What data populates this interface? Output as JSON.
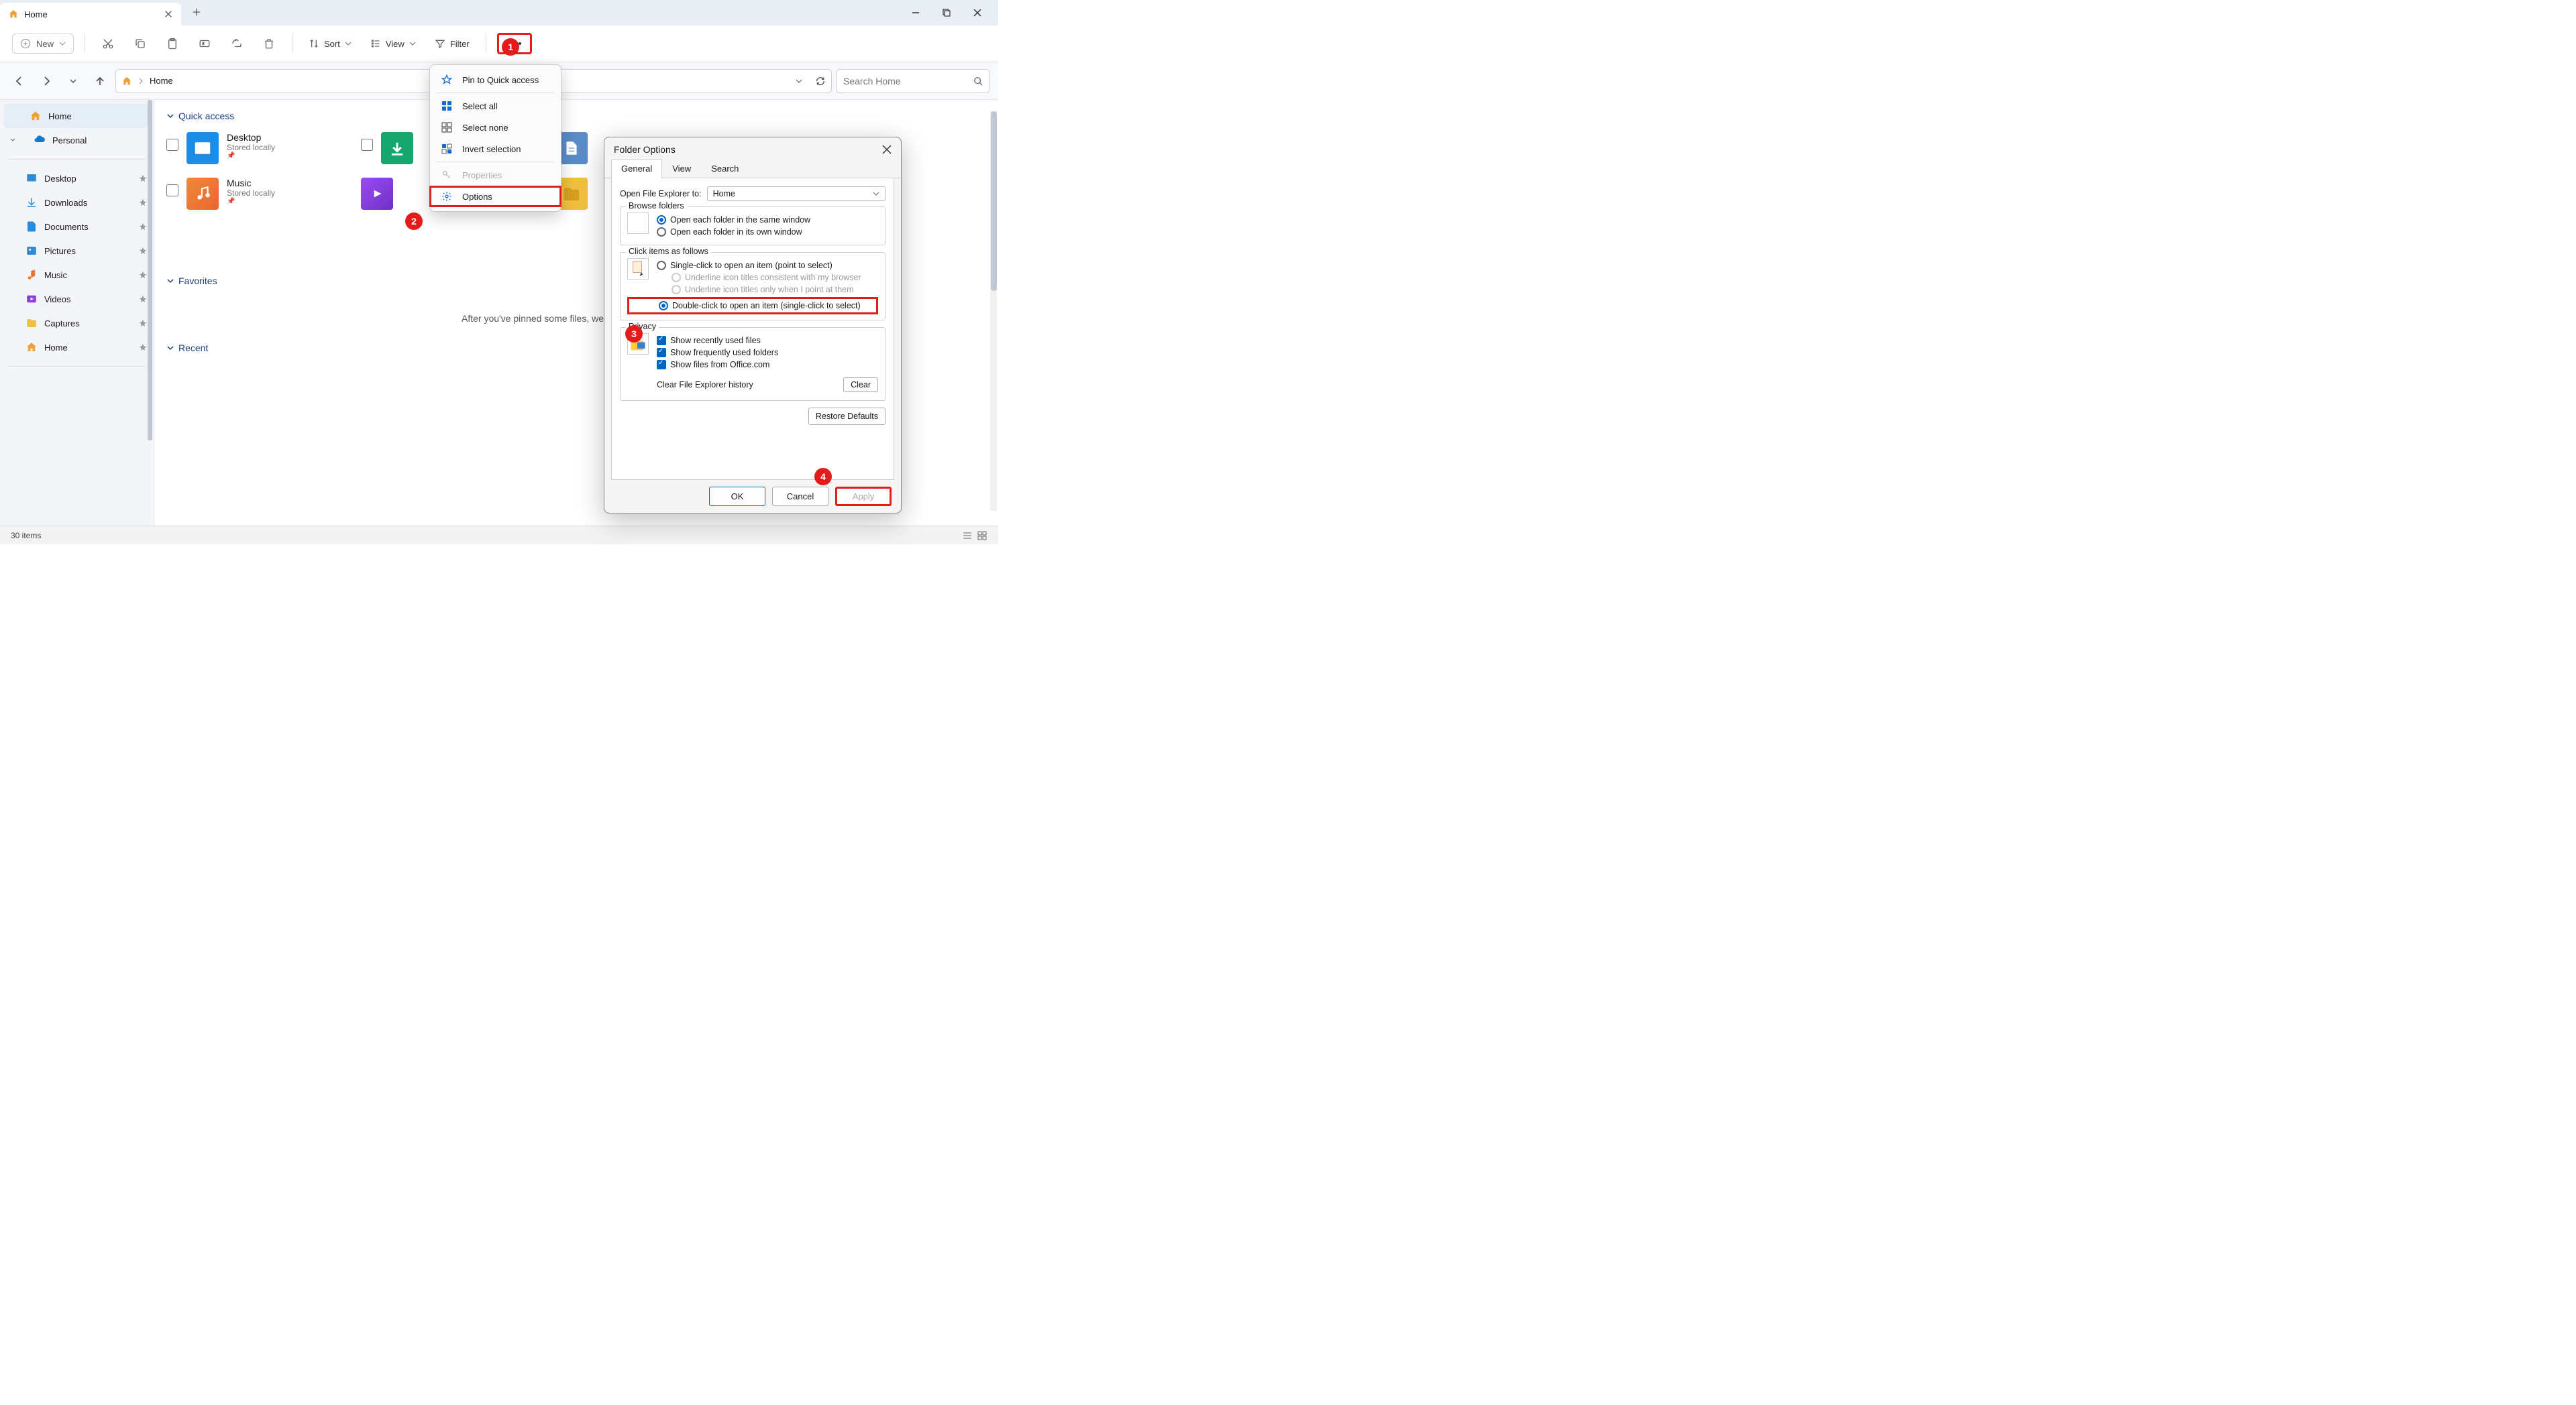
{
  "window": {
    "tab_title": "Home",
    "new_btn": "New",
    "sort_btn": "Sort",
    "view_btn": "View",
    "filter_btn": "Filter"
  },
  "address": {
    "path": "Home",
    "search_placeholder": "Search Home"
  },
  "sidebar": {
    "items": [
      {
        "label": "Home",
        "selected": true
      },
      {
        "label": "Personal"
      }
    ],
    "quick": [
      {
        "label": "Desktop"
      },
      {
        "label": "Downloads"
      },
      {
        "label": "Documents"
      },
      {
        "label": "Pictures"
      },
      {
        "label": "Music"
      },
      {
        "label": "Videos"
      },
      {
        "label": "Captures"
      },
      {
        "label": "Home"
      }
    ]
  },
  "content": {
    "section_qa": "Quick access",
    "section_fav": "Favorites",
    "section_recent": "Recent",
    "qa_items": [
      {
        "title": "Desktop",
        "sub": "Stored locally"
      },
      {
        "title": "Music",
        "sub": "Stored locally"
      }
    ],
    "empty_favorites": "After you've pinned some files, we'"
  },
  "context_menu": {
    "pin": "Pin to Quick access",
    "select_all": "Select all",
    "select_none": "Select none",
    "invert": "Invert selection",
    "properties": "Properties",
    "options": "Options"
  },
  "dialog": {
    "title": "Folder Options",
    "tabs": [
      "General",
      "View",
      "Search"
    ],
    "open_to_label": "Open File Explorer to:",
    "open_to_value": "Home",
    "browse_title": "Browse folders",
    "browse_same": "Open each folder in the same window",
    "browse_own": "Open each folder in its own window",
    "click_title": "Click items as follows",
    "click_single": "Single-click to open an item (point to select)",
    "click_under_browser": "Underline icon titles consistent with my browser",
    "click_under_point": "Underline icon titles only when I point at them",
    "click_double": "Double-click to open an item (single-click to select)",
    "privacy_title": "Privacy",
    "priv_recent_files": "Show recently used files",
    "priv_freq_folders": "Show frequently used folders",
    "priv_office": "Show files from Office.com",
    "clear_label": "Clear File Explorer history",
    "clear_btn": "Clear",
    "restore_btn": "Restore Defaults",
    "ok": "OK",
    "cancel": "Cancel",
    "apply": "Apply"
  },
  "annotations": {
    "b1": "1",
    "b2": "2",
    "b3": "3",
    "b4": "4"
  },
  "status": {
    "count": "30 items"
  }
}
